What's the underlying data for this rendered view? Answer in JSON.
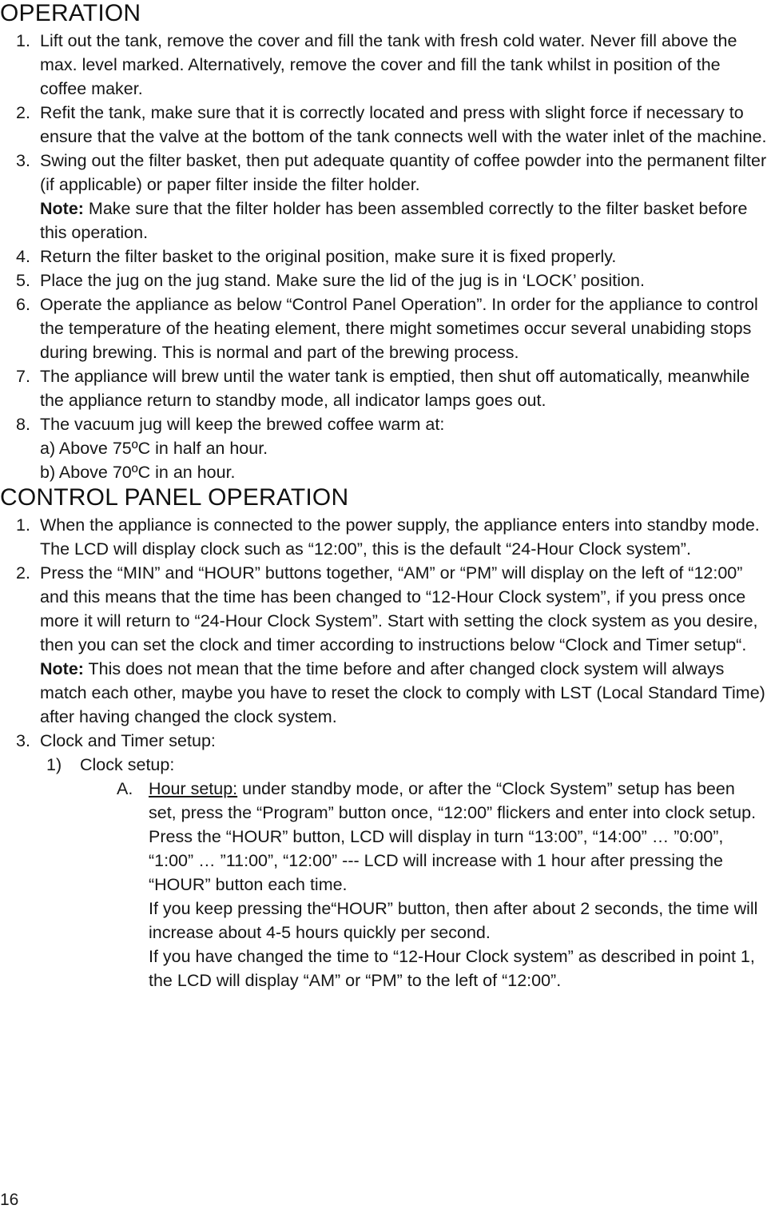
{
  "document": {
    "page_number": "16"
  },
  "sections": [
    {
      "heading": "OPERATION",
      "steps": [
        {
          "marker": "1.",
          "text": "Lift out the tank, remove the cover and fill the tank with fresh cold water. Never fill above the max. level marked. Alternatively, remove the cover and fill the tank whilst in position of the coffee maker."
        },
        {
          "marker": "2.",
          "text": "Refit the tank, make sure that it is correctly located and press with slight force if necessary to ensure that the valve at the bottom of the tank connects well with the water inlet of the machine."
        },
        {
          "marker": "3.",
          "text": "Swing out the filter basket, then put adequate quantity of coffee powder into the permanent filter (if applicable) or paper filter inside the filter holder.",
          "note_label": "Note:",
          "note_text": " Make sure that the filter holder has been assembled correctly to the filter basket before this operation."
        },
        {
          "marker": "4.",
          "text": "Return the filter basket to the original position, make sure it is fixed properly."
        },
        {
          "marker": "5.",
          "text": "Place the jug on the jug stand. Make sure the lid of the jug is in ‘LOCK’ position."
        },
        {
          "marker": "6.",
          "text": "Operate the appliance as below “Control Panel Operation”. In order for the appliance to control the temperature of the heating element, there might sometimes occur several unabiding stops during brewing. This is normal and part of the brewing process."
        },
        {
          "marker": "7.",
          "text": "The appliance will brew until the water tank is emptied, then shut off automatically, meanwhile the appliance return to standby mode, all indicator lamps goes out."
        },
        {
          "marker": "8.",
          "text": "The vacuum jug will keep the brewed coffee warm at:",
          "sub_lines": [
            "a) Above 75ºC in half an hour.",
            "b) Above 70ºC in an hour."
          ]
        }
      ]
    },
    {
      "heading": "CONTROL PANEL OPERATION",
      "steps": [
        {
          "marker": "1.",
          "text": "When the appliance is connected to the power supply, the appliance enters into standby mode. The LCD will display clock such as “12:00”, this is the default “24-Hour Clock system”."
        },
        {
          "marker": "2.",
          "text": "Press the “MIN” and “HOUR” buttons together, “AM” or “PM” will display on the left of “12:00” and this means that the time has been changed to “12-Hour Clock system”, if you press once more it will return to “24-Hour Clock System”. Start with setting the clock system as you desire, then you can set the clock and timer according to instructions below “Clock and Timer setup“.",
          "note_label": "Note:",
          "note_text": " This does not mean that the time before and after changed clock system will always match each other, maybe you have to reset the clock to comply with LST (Local Standard Time) after having changed the clock system."
        },
        {
          "marker": "3.",
          "text": "Clock and Timer setup:",
          "substeps": [
            {
              "marker": "1)",
              "text": "Clock setup:",
              "subsubsteps": [
                {
                  "marker": "A.",
                  "underlined_lead": "Hour setup:",
                  "paragraphs": [
                    " under standby mode, or after the “Clock System” setup has been set, press the “Program” button once, “12:00” flickers and enter into clock setup. Press the “HOUR” button, LCD will display in turn “13:00”, “14:00” … ”0:00”, “1:00” … ”11:00”, “12:00” --- LCD will increase with 1 hour after pressing the “HOUR” button each time.",
                    "If you keep pressing the“HOUR” button, then after about 2 seconds, the time will increase about 4-5 hours quickly per second.",
                    "If you have changed the time to “12-Hour Clock system” as described in point 1, the LCD will display “AM” or “PM” to the left of “12:00”."
                  ]
                }
              ]
            }
          ]
        }
      ]
    }
  ]
}
